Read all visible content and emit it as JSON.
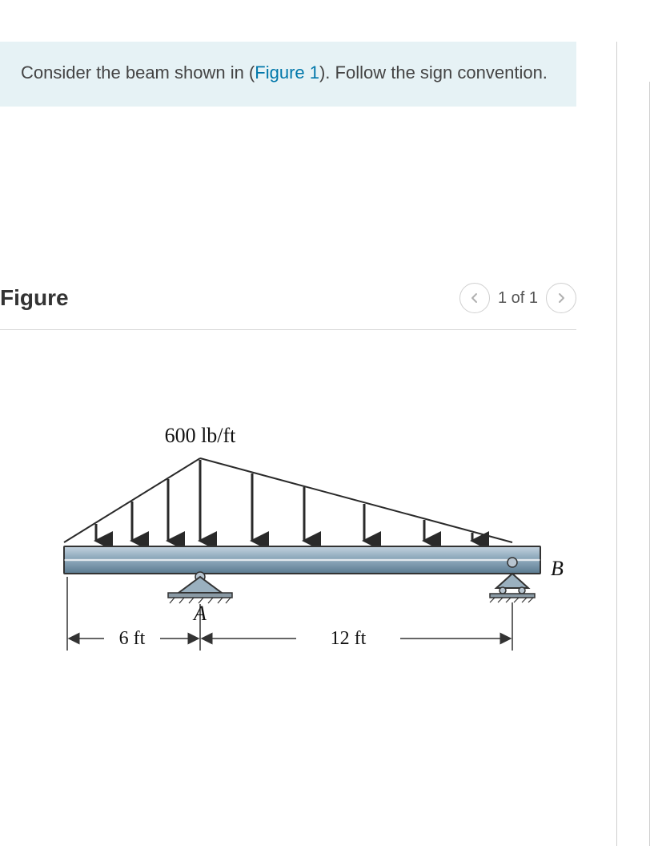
{
  "instruction": {
    "prefix": "Consider the beam shown in (",
    "link_text": "Figure 1",
    "suffix": "). Follow the sign convention."
  },
  "figure_header": {
    "title": "Figure",
    "pager_text": "1 of 1"
  },
  "diagram": {
    "load_label": "600 lb/ft",
    "point_A": "A",
    "point_B": "B",
    "dim_left": "6 ft",
    "dim_right": "12 ft"
  }
}
